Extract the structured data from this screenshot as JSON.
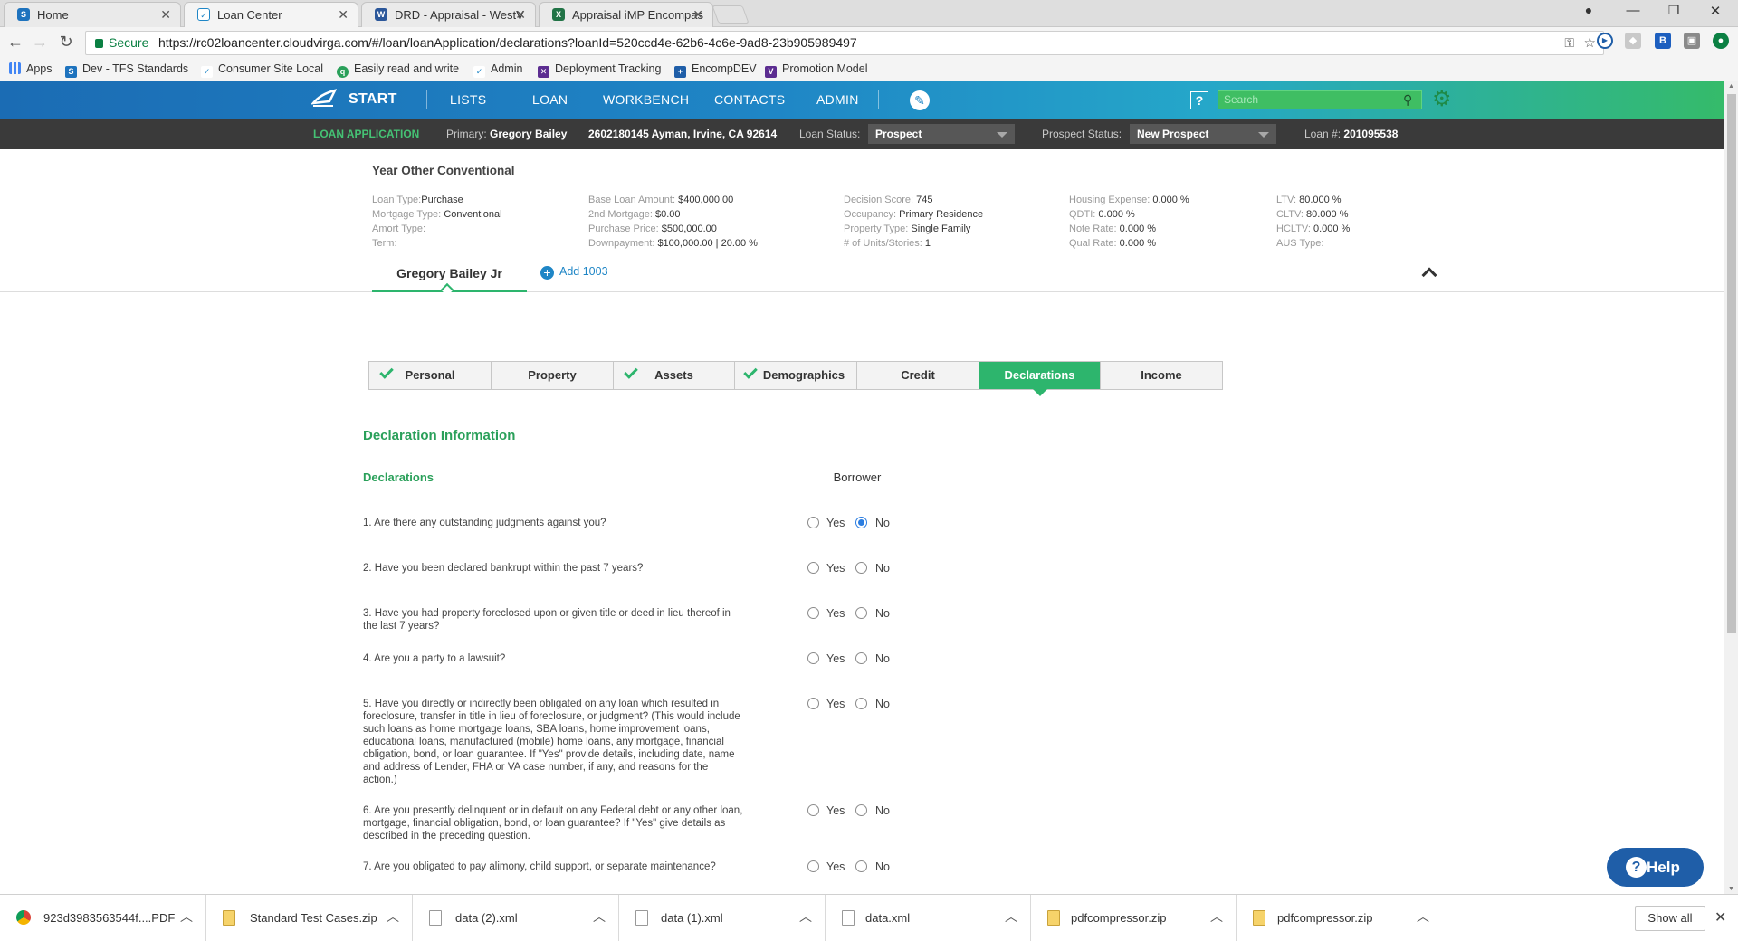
{
  "browser": {
    "tabs": [
      {
        "title": "Home",
        "favicon": "S"
      },
      {
        "title": "Loan Center",
        "favicon": "LC"
      },
      {
        "title": "DRD - Appraisal - WestV",
        "favicon": "W"
      },
      {
        "title": "Appraisal iMP Encompas",
        "favicon": "X"
      }
    ],
    "secure_label": "Secure",
    "url": "https://rc02loancenter.cloudvirga.com/#/loan/loanApplication/declarations?loanId=520ccd4e-62b6-4c6e-9ad8-23b905989497",
    "bookmarks": [
      "Apps",
      "Dev - TFS Standards",
      "Consumer Site Local",
      "Easily read and write",
      "Admin",
      "Deployment Tracking",
      "EncompDEV",
      "Promotion Model"
    ]
  },
  "app_nav": {
    "brand": "START",
    "items": [
      "LISTS",
      "LOAN",
      "WORKBENCH",
      "CONTACTS",
      "ADMIN"
    ],
    "search_placeholder": "Search",
    "help_glyph": "?"
  },
  "status_bar": {
    "section": "LOAN APPLICATION",
    "primary_label": "Primary:",
    "primary_value": "Gregory Bailey",
    "address": "2602180145 Ayman, Irvine, CA 92614",
    "loan_status_label": "Loan Status:",
    "loan_status_value": "Prospect",
    "prospect_status_label": "Prospect Status:",
    "prospect_status_value": "New Prospect",
    "loan_number_label": "Loan #:",
    "loan_number_value": "201095538"
  },
  "summary": {
    "title": "Year Other Conventional",
    "col1": [
      {
        "label": "Loan Type:",
        "value": "Purchase"
      },
      {
        "label": "Mortgage Type:",
        "value": "Conventional"
      },
      {
        "label": "Amort Type:",
        "value": ""
      },
      {
        "label": "Term:",
        "value": ""
      }
    ],
    "col2": [
      {
        "label": "Base Loan Amount:",
        "value": "$400,000.00"
      },
      {
        "label": "2nd Mortgage:",
        "value": "$0.00"
      },
      {
        "label": "Purchase Price:",
        "value": "$500,000.00"
      },
      {
        "label": "Downpayment:",
        "value": "$100,000.00 | 20.00 %"
      }
    ],
    "col3": [
      {
        "label": "Decision Score:",
        "value": "745"
      },
      {
        "label": "Occupancy:",
        "value": "Primary Residence"
      },
      {
        "label": "Property Type:",
        "value": "Single Family"
      },
      {
        "label": "# of Units/Stories:",
        "value": "1"
      }
    ],
    "col4": [
      {
        "label": "Housing Expense:",
        "value": "0.000 %"
      },
      {
        "label": "QDTI:",
        "value": "0.000 %"
      },
      {
        "label": "Note Rate:",
        "value": "0.000 %"
      },
      {
        "label": "Qual Rate:",
        "value": "0.000 %"
      }
    ],
    "col5": [
      {
        "label": "LTV:",
        "value": "80.000 %"
      },
      {
        "label": "CLTV:",
        "value": "80.000 %"
      },
      {
        "label": "HCLTV:",
        "value": "0.000 %"
      },
      {
        "label": "AUS Type:",
        "value": ""
      }
    ],
    "borrower_tab": "Gregory Bailey Jr",
    "add_1003": "Add 1003"
  },
  "steps": [
    {
      "label": "Personal",
      "complete": true,
      "active": false
    },
    {
      "label": "Property",
      "complete": false,
      "active": false
    },
    {
      "label": "Assets",
      "complete": true,
      "active": false
    },
    {
      "label": "Demographics",
      "complete": true,
      "active": false
    },
    {
      "label": "Credit",
      "complete": false,
      "active": false
    },
    {
      "label": "Declarations",
      "complete": false,
      "active": true
    },
    {
      "label": "Income",
      "complete": false,
      "active": false
    }
  ],
  "declarations": {
    "section_title": "Declaration Information",
    "header_left": "Declarations",
    "header_right": "Borrower",
    "yes_label": "Yes",
    "no_label": "No",
    "questions": [
      {
        "text": "1. Are there any outstanding judgments against you?",
        "answer": "No"
      },
      {
        "text": "2. Have you been declared bankrupt within the past 7 years?",
        "answer": ""
      },
      {
        "text": "3. Have you had property foreclosed upon or given title or deed in lieu thereof in the last 7 years?",
        "answer": ""
      },
      {
        "text": "4. Are you a party to a lawsuit?",
        "answer": ""
      },
      {
        "text": "5. Have you directly or indirectly been obligated on any loan which resulted in foreclosure, transfer in title in lieu of foreclosure, or judgment? (This would include such loans as home mortgage loans, SBA loans, home improvement loans, educational loans, manufactured (mobile) home loans, any mortgage, financial obligation, bond, or loan guarantee. If \"Yes\" provide details, including date, name and address of Lender, FHA or VA case number, if any, and reasons for the action.)",
        "answer": ""
      },
      {
        "text": "6. Are you presently delinquent or in default on any Federal debt or any other loan, mortgage, financial obligation, bond, or loan guarantee? If \"Yes\" give details as described in the preceding question.",
        "answer": ""
      },
      {
        "text": "7. Are you obligated to pay alimony, child support, or separate maintenance?",
        "answer": ""
      }
    ]
  },
  "help_button": "Help",
  "downloads": {
    "items": [
      {
        "name": "923d3983563544f....PDF",
        "type": "pdf"
      },
      {
        "name": "Standard Test Cases.zip",
        "type": "zip"
      },
      {
        "name": "data (2).xml",
        "type": "file"
      },
      {
        "name": "data (1).xml",
        "type": "file"
      },
      {
        "name": "data.xml",
        "type": "file"
      },
      {
        "name": "pdfcompressor.zip",
        "type": "zip"
      },
      {
        "name": "pdfcompressor.zip",
        "type": "zip"
      }
    ],
    "show_all": "Show all"
  },
  "colors": {
    "accent_green": "#2db56d",
    "nav_blue": "#1b6cb4",
    "status_bar": "#3a3a3a",
    "help_blue": "#1f5ea8",
    "radio_selected": "#2b7de0"
  }
}
